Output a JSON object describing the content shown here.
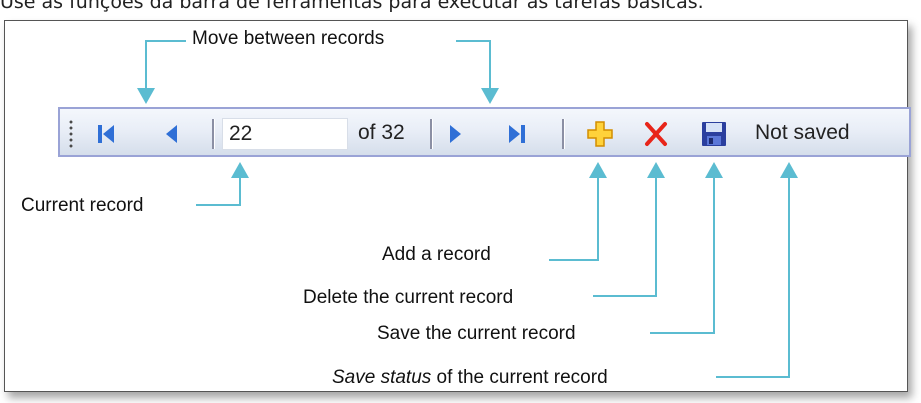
{
  "intro_text": "Use as funções da barra de ferramentas para executar as tarefas básicas.",
  "toolbar": {
    "current_record_value": "22",
    "record_total": "of 32",
    "save_status": "Not saved",
    "buttons": [
      {
        "id": "first",
        "icon": "first-record-icon"
      },
      {
        "id": "previous",
        "icon": "previous-record-icon"
      },
      {
        "id": "next",
        "icon": "next-record-icon"
      },
      {
        "id": "last",
        "icon": "last-record-icon"
      },
      {
        "id": "add",
        "icon": "plus-icon"
      },
      {
        "id": "delete",
        "icon": "x-delete-icon"
      },
      {
        "id": "save",
        "icon": "floppy-disk-icon"
      }
    ]
  },
  "callouts": {
    "move_between_records": "Move between records",
    "current_record": "Current record",
    "add_record": "Add a record",
    "delete_record": "Delete the current record",
    "save_record": "Save the current record",
    "save_status_italic": "Save status",
    "save_status_rest": " of the current record"
  },
  "colors": {
    "leader_line": "#5bbcd1",
    "nav_arrow": "#2f6fd6",
    "add_icon": "#f5b400",
    "delete_icon": "#e8251a",
    "toolbar_border": "#9aa3d6"
  }
}
